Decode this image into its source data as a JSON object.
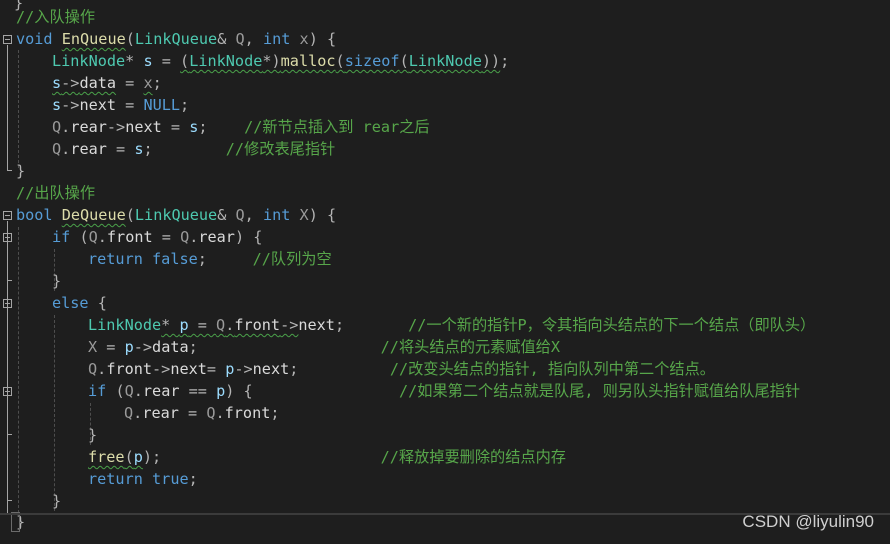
{
  "editor": {
    "watermark": "CSDN @liyulin90",
    "lines": {
      "l0": [
        {
          "t": "}",
          "c": "op"
        }
      ],
      "l1": [
        {
          "t": "//入队操作",
          "c": "cm"
        }
      ],
      "l2": [
        {
          "t": "void",
          "c": "kw"
        },
        {
          "t": " ",
          "c": ""
        },
        {
          "t": "EnQueue",
          "c": "fn sq"
        },
        {
          "t": "(",
          "c": "op"
        },
        {
          "t": "LinkQueue",
          "c": "ty"
        },
        {
          "t": "& ",
          "c": "op"
        },
        {
          "t": "Q",
          "c": "pa"
        },
        {
          "t": ", ",
          "c": "op"
        },
        {
          "t": "int",
          "c": "kw"
        },
        {
          "t": " ",
          "c": ""
        },
        {
          "t": "x",
          "c": "pa"
        },
        {
          "t": ") {",
          "c": "op"
        }
      ],
      "l3": [
        {
          "t": "LinkNode",
          "c": "ty"
        },
        {
          "t": "* ",
          "c": "op"
        },
        {
          "t": "s",
          "c": "var"
        },
        {
          "t": " = ",
          "c": "op"
        },
        {
          "t": "(",
          "c": "op sq"
        },
        {
          "t": "LinkNode",
          "c": "ty sq"
        },
        {
          "t": "*)",
          "c": "op sq"
        },
        {
          "t": "malloc",
          "c": "fn sq"
        },
        {
          "t": "(",
          "c": "op sq"
        },
        {
          "t": "sizeof",
          "c": "kw sq"
        },
        {
          "t": "(",
          "c": "op sq"
        },
        {
          "t": "LinkNode",
          "c": "ty sq"
        },
        {
          "t": "))",
          "c": "op sq"
        },
        {
          "t": ";",
          "c": "op"
        }
      ],
      "l4": [
        {
          "t": "s",
          "c": "var sq"
        },
        {
          "t": "->",
          "c": "op sq"
        },
        {
          "t": "data",
          "c": "mem sq"
        },
        {
          "t": " = ",
          "c": "op"
        },
        {
          "t": "x",
          "c": "pa sq"
        },
        {
          "t": ";",
          "c": "op"
        }
      ],
      "l5": [
        {
          "t": "s",
          "c": "var"
        },
        {
          "t": "->",
          "c": "op"
        },
        {
          "t": "next",
          "c": "mem"
        },
        {
          "t": " = ",
          "c": "op"
        },
        {
          "t": "NULL",
          "c": "kw"
        },
        {
          "t": ";",
          "c": "op"
        }
      ],
      "l6": [
        {
          "t": "Q",
          "c": "pa"
        },
        {
          "t": ".",
          "c": "op"
        },
        {
          "t": "rear",
          "c": "mem"
        },
        {
          "t": "->",
          "c": "op"
        },
        {
          "t": "next",
          "c": "mem"
        },
        {
          "t": " = ",
          "c": "op"
        },
        {
          "t": "s",
          "c": "var"
        },
        {
          "t": ";    ",
          "c": "op"
        },
        {
          "t": "//新节点插入到 rear之后",
          "c": "cm"
        }
      ],
      "l7": [
        {
          "t": "Q",
          "c": "pa"
        },
        {
          "t": ".",
          "c": "op"
        },
        {
          "t": "rear",
          "c": "mem"
        },
        {
          "t": " = ",
          "c": "op"
        },
        {
          "t": "s",
          "c": "var"
        },
        {
          "t": ";        ",
          "c": "op"
        },
        {
          "t": "//修改表尾指针",
          "c": "cm"
        }
      ],
      "l8": [
        {
          "t": "}",
          "c": "op"
        }
      ],
      "l9": [
        {
          "t": "//出队操作",
          "c": "cm"
        }
      ],
      "l10": [
        {
          "t": "bool",
          "c": "kw"
        },
        {
          "t": " ",
          "c": ""
        },
        {
          "t": "DeQueue",
          "c": "fn sq"
        },
        {
          "t": "(",
          "c": "op"
        },
        {
          "t": "LinkQueue",
          "c": "ty"
        },
        {
          "t": "& ",
          "c": "op"
        },
        {
          "t": "Q",
          "c": "pa"
        },
        {
          "t": ", ",
          "c": "op"
        },
        {
          "t": "int",
          "c": "kw"
        },
        {
          "t": " ",
          "c": ""
        },
        {
          "t": "X",
          "c": "pa"
        },
        {
          "t": ") {",
          "c": "op"
        }
      ],
      "l11": [
        {
          "t": "if",
          "c": "kw"
        },
        {
          "t": " (",
          "c": "op"
        },
        {
          "t": "Q",
          "c": "pa"
        },
        {
          "t": ".",
          "c": "op"
        },
        {
          "t": "front",
          "c": "mem"
        },
        {
          "t": " = ",
          "c": "op"
        },
        {
          "t": "Q",
          "c": "pa"
        },
        {
          "t": ".",
          "c": "op"
        },
        {
          "t": "rear",
          "c": "mem"
        },
        {
          "t": ") {",
          "c": "op"
        }
      ],
      "l12": [
        {
          "t": "return",
          "c": "kw"
        },
        {
          "t": " ",
          "c": ""
        },
        {
          "t": "false",
          "c": "kw"
        },
        {
          "t": ";     ",
          "c": "op"
        },
        {
          "t": "//队列为空",
          "c": "cm"
        }
      ],
      "l13": [
        {
          "t": "}",
          "c": "op"
        }
      ],
      "l14": [
        {
          "t": "else",
          "c": "kw"
        },
        {
          "t": " {",
          "c": "op"
        }
      ],
      "l15": [
        {
          "t": "LinkNode",
          "c": "ty"
        },
        {
          "t": "* ",
          "c": "op sq"
        },
        {
          "t": "p",
          "c": "var sq"
        },
        {
          "t": " = ",
          "c": "op sq"
        },
        {
          "t": "Q",
          "c": "pa sq"
        },
        {
          "t": ".",
          "c": "op sq"
        },
        {
          "t": "front",
          "c": "mem sq"
        },
        {
          "t": "->",
          "c": "op sq"
        },
        {
          "t": "next",
          "c": "mem"
        },
        {
          "t": ";       ",
          "c": "op"
        },
        {
          "t": "//一个新的指针P，令其指向头结点的下一个结点（即队头）",
          "c": "cm"
        }
      ],
      "l16": [
        {
          "t": "X",
          "c": "pa"
        },
        {
          "t": " = ",
          "c": "op"
        },
        {
          "t": "p",
          "c": "var"
        },
        {
          "t": "->",
          "c": "op"
        },
        {
          "t": "data",
          "c": "mem"
        },
        {
          "t": ";                    ",
          "c": "op"
        },
        {
          "t": "//将头结点的元素赋值给X",
          "c": "cm"
        }
      ],
      "l17": [
        {
          "t": "Q",
          "c": "pa"
        },
        {
          "t": ".",
          "c": "op"
        },
        {
          "t": "front",
          "c": "mem"
        },
        {
          "t": "->",
          "c": "op"
        },
        {
          "t": "next",
          "c": "mem"
        },
        {
          "t": "= ",
          "c": "op"
        },
        {
          "t": "p",
          "c": "var"
        },
        {
          "t": "->",
          "c": "op"
        },
        {
          "t": "next",
          "c": "mem"
        },
        {
          "t": ";          ",
          "c": "op"
        },
        {
          "t": "//改变头结点的指针, 指向队列中第二个结点。",
          "c": "cm"
        }
      ],
      "l18": [
        {
          "t": "if",
          "c": "kw"
        },
        {
          "t": " (",
          "c": "op"
        },
        {
          "t": "Q",
          "c": "pa"
        },
        {
          "t": ".",
          "c": "op"
        },
        {
          "t": "rear",
          "c": "mem"
        },
        {
          "t": " == ",
          "c": "op"
        },
        {
          "t": "p",
          "c": "var"
        },
        {
          "t": ") {",
          "c": "op"
        },
        {
          "t": "                ",
          "c": ""
        },
        {
          "t": "//如果第二个结点就是队尾, 则另队头指针赋值给队尾指针",
          "c": "cm"
        }
      ],
      "l19": [
        {
          "t": "Q",
          "c": "pa"
        },
        {
          "t": ".",
          "c": "op"
        },
        {
          "t": "rear",
          "c": "mem"
        },
        {
          "t": " = ",
          "c": "op"
        },
        {
          "t": "Q",
          "c": "pa"
        },
        {
          "t": ".",
          "c": "op"
        },
        {
          "t": "front",
          "c": "mem"
        },
        {
          "t": ";",
          "c": "op"
        }
      ],
      "l20": [
        {
          "t": "}",
          "c": "op"
        }
      ],
      "l21": [
        {
          "t": "free",
          "c": "fn sq"
        },
        {
          "t": "(",
          "c": "op sq"
        },
        {
          "t": "p",
          "c": "var sq"
        },
        {
          "t": ");",
          "c": "op"
        },
        {
          "t": "                        ",
          "c": ""
        },
        {
          "t": "//释放掉要删除的结点内存",
          "c": "cm"
        }
      ],
      "l22": [
        {
          "t": "return",
          "c": "kw"
        },
        {
          "t": " ",
          "c": ""
        },
        {
          "t": "true",
          "c": "kw"
        },
        {
          "t": ";",
          "c": "op"
        }
      ],
      "l23": [
        {
          "t": "}",
          "c": "op"
        }
      ],
      "l24": [
        {
          "t": "}",
          "c": "op"
        }
      ]
    }
  }
}
